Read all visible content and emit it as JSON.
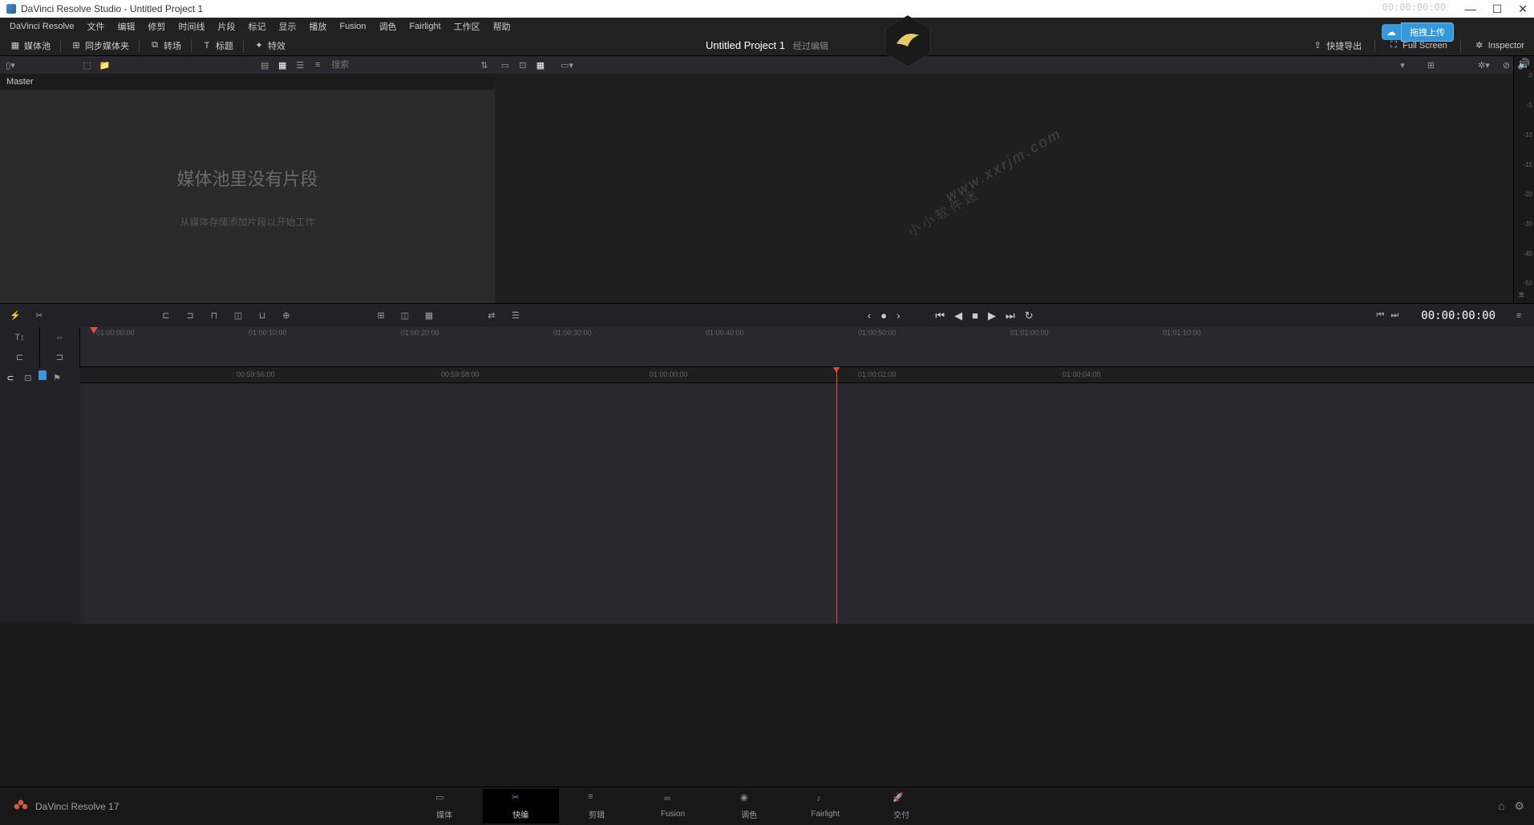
{
  "titlebar": {
    "title": "DaVinci Resolve Studio - Untitled Project 1"
  },
  "menubar": [
    "DaVinci Resolve",
    "文件",
    "编辑",
    "修剪",
    "时间线",
    "片段",
    "标记",
    "显示",
    "播放",
    "Fusion",
    "调色",
    "Fairlight",
    "工作区",
    "帮助"
  ],
  "toolbar": {
    "media_pool": "媒体池",
    "sync_bin": "同步媒体夹",
    "transitions": "转场",
    "titles": "标题",
    "effects": "特效",
    "project": "Untitled Project 1",
    "subtitle": "经过编辑",
    "quick_export": "快捷导出",
    "full_screen": "Full Screen",
    "inspector": "Inspector"
  },
  "upload": {
    "button": "拖拽上传"
  },
  "media": {
    "master": "Master",
    "search_placeholder": "搜索",
    "empty_title": "媒体池里没有片段",
    "empty_sub": "从媒体存储添加片段以开始工作"
  },
  "viewer": {
    "timecode_top": "00:00:00:00",
    "watermark_url": "www.xxrjm.com",
    "watermark_text": "小小软件迷"
  },
  "audio_meter": {
    "labels": [
      "0",
      "-5",
      "-10",
      "-15",
      "-20",
      "-30",
      "-40",
      "-50"
    ]
  },
  "transport": {
    "timecode": "00:00:00:00"
  },
  "timeline": {
    "upper_ticks": [
      {
        "pos": 20,
        "label": "01:00:00:00"
      },
      {
        "pos": 210,
        "label": "01:00:10:00"
      },
      {
        "pos": 400,
        "label": "01:00:20:00"
      },
      {
        "pos": 590,
        "label": "01:00:30:00"
      },
      {
        "pos": 780,
        "label": "01:00:40:00"
      },
      {
        "pos": 970,
        "label": "01:00:50:00"
      },
      {
        "pos": 1160,
        "label": "01:01:00:00"
      },
      {
        "pos": 1350,
        "label": "01:01:10:00"
      }
    ],
    "main_ticks": [
      {
        "pos": 195,
        "label": "00:59:56:00"
      },
      {
        "pos": 450,
        "label": "00:59:58:00"
      },
      {
        "pos": 710,
        "label": "01:00:00:00"
      },
      {
        "pos": 970,
        "label": "01:00:02:00"
      },
      {
        "pos": 1225,
        "label": "01:00:04:00"
      }
    ]
  },
  "footer": {
    "version": "DaVinci Resolve 17",
    "pages": [
      {
        "id": "media",
        "label": "媒体"
      },
      {
        "id": "cut",
        "label": "快编",
        "active": true
      },
      {
        "id": "edit",
        "label": "剪辑"
      },
      {
        "id": "fusion",
        "label": "Fusion"
      },
      {
        "id": "color",
        "label": "调色"
      },
      {
        "id": "fairlight",
        "label": "Fairlight"
      },
      {
        "id": "deliver",
        "label": "交付"
      }
    ]
  }
}
